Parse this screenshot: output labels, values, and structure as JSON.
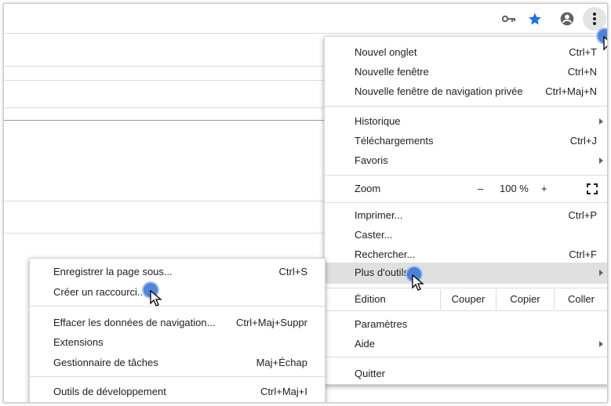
{
  "menu": {
    "new_tab": {
      "label": "Nouvel onglet",
      "shortcut": "Ctrl+T"
    },
    "new_window": {
      "label": "Nouvelle fenêtre",
      "shortcut": "Ctrl+N"
    },
    "incognito": {
      "label": "Nouvelle fenêtre de navigation privée",
      "shortcut": "Ctrl+Maj+N"
    },
    "history": {
      "label": "Historique"
    },
    "downloads": {
      "label": "Téléchargements",
      "shortcut": "Ctrl+J"
    },
    "bookmarks": {
      "label": "Favoris"
    },
    "zoom": {
      "label": "Zoom",
      "minus": "–",
      "value": "100 %",
      "plus": "+"
    },
    "print": {
      "label": "Imprimer...",
      "shortcut": "Ctrl+P"
    },
    "cast": {
      "label": "Caster..."
    },
    "find": {
      "label": "Rechercher...",
      "shortcut": "Ctrl+F"
    },
    "more_tools": {
      "label": "Plus d'outils"
    },
    "edit": {
      "label": "Édition",
      "cut": "Couper",
      "copy": "Copier",
      "paste": "Coller"
    },
    "settings": {
      "label": "Paramètres"
    },
    "help": {
      "label": "Aide"
    },
    "exit": {
      "label": "Quitter"
    }
  },
  "submenu": {
    "save_page": {
      "label": "Enregistrer la page sous...",
      "shortcut": "Ctrl+S"
    },
    "create_shortcut": {
      "label": "Créer un raccourci..."
    },
    "clear_data": {
      "label": "Effacer les données de navigation...",
      "shortcut": "Ctrl+Maj+Suppr"
    },
    "extensions": {
      "label": "Extensions"
    },
    "task_manager": {
      "label": "Gestionnaire de tâches",
      "shortcut": "Maj+Échap"
    },
    "dev_tools": {
      "label": "Outils de développement",
      "shortcut": "Ctrl+Maj+I"
    }
  },
  "icons": {
    "key": "key-icon",
    "star": "star-icon",
    "profile": "profile-icon",
    "menu": "kebab-menu-icon"
  },
  "colors": {
    "accent": "#3b78d8",
    "highlight": "#e0e0e0",
    "star": "#1a73e8"
  }
}
